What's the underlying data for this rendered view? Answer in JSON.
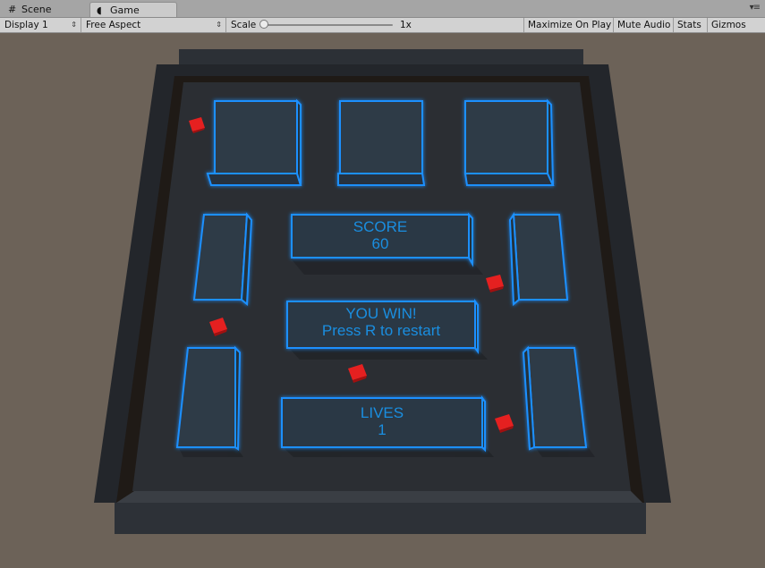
{
  "tabs": [
    {
      "label": "Scene",
      "icon": "grid-icon"
    },
    {
      "label": "Game",
      "icon": "pacman-icon"
    }
  ],
  "toolbar": {
    "display": "Display 1",
    "aspect": "Free Aspect",
    "scale_label": "Scale",
    "scale_value": "1x",
    "maximize": "Maximize On Play",
    "mute": "Mute Audio",
    "stats": "Stats",
    "gizmos": "Gizmos"
  },
  "game": {
    "score_label": "SCORE",
    "score_value": "60",
    "win_message": "YOU WIN!",
    "restart_message": "Press R to restart",
    "lives_label": "LIVES",
    "lives_value": "1"
  },
  "colors": {
    "background": "#6c6258",
    "board": "#2b2e33",
    "wall_glow": "#1e90ff",
    "pellet": "#e52020",
    "hud_text": "#1a8ee0"
  }
}
